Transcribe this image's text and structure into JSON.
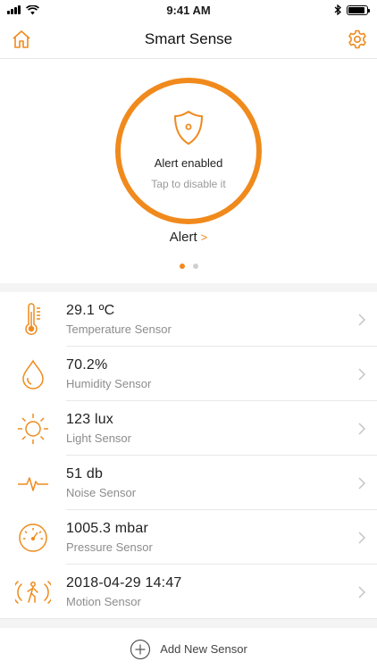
{
  "status_bar": {
    "time": "9:41 AM",
    "battery_level": 0.9
  },
  "nav": {
    "title": "Smart Sense",
    "left_icon": "home-icon",
    "right_icon": "gear-icon"
  },
  "alert": {
    "status": "Alert enabled",
    "hint": "Tap to disable it",
    "link_label": "Alert",
    "link_chevron": ">",
    "pages": 2,
    "active_page": 1
  },
  "sensors": [
    {
      "value": "29.1 ºC",
      "name": "Temperature Sensor",
      "icon": "thermometer-icon"
    },
    {
      "value": "70.2%",
      "name": "Humidity Sensor",
      "icon": "droplet-icon"
    },
    {
      "value": "123 lux",
      "name": "Light Sensor",
      "icon": "sun-icon"
    },
    {
      "value": "51 db",
      "name": "Noise Sensor",
      "icon": "waveform-icon"
    },
    {
      "value": "1005.3 mbar",
      "name": "Pressure Sensor",
      "icon": "gauge-icon"
    },
    {
      "value": "2018-04-29 14:47",
      "name": "Motion Sensor",
      "icon": "motion-icon"
    }
  ],
  "add_sensor": {
    "label": "Add New Sensor",
    "icon": "plus-circle-icon"
  },
  "colors": {
    "accent": "#f08a1c",
    "text": "#222222",
    "secondary": "#8c8c8c",
    "divider": "#e8e8e8"
  }
}
